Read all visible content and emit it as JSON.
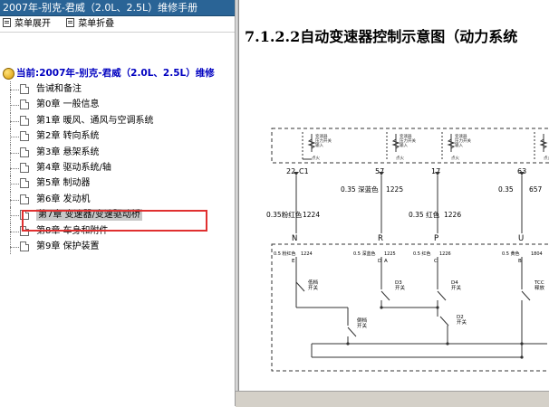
{
  "window": {
    "title": "2007年-别克-君威（2.0L、2.5L）维修手册"
  },
  "toolbar": {
    "expand_label": "菜单展开",
    "collapse_label": "菜单折叠"
  },
  "tree": {
    "root_label": "当前:2007年-别克-君威（2.0L、2.5L）维修",
    "items": [
      {
        "label": "告诫和备注"
      },
      {
        "label": "第0章 一般信息"
      },
      {
        "label": "第1章 暖风、通风与空调系统"
      },
      {
        "label": "第2章 转向系统"
      },
      {
        "label": "第3章 悬架系统"
      },
      {
        "label": "第4章 驱动系统/轴"
      },
      {
        "label": "第5章 制动器"
      },
      {
        "label": "第6章 发动机"
      },
      {
        "label": "第7章 变速器/变速驱动桥"
      },
      {
        "label": "第8章 车身和附件"
      },
      {
        "label": "第9章 保护装置"
      }
    ],
    "selected_index": 8
  },
  "content": {
    "title": "7.1.2.2自动变速器控制示意图（动力系统",
    "diagram": {
      "module_label": "变速器\n压力开关\n输入",
      "ignition_label": "点火",
      "pins_top": [
        "22",
        "C1",
        "57",
        "17",
        "63"
      ],
      "wires": [
        "0.35 深蓝色",
        "1225",
        "0.35 红色",
        "1226",
        "0.35",
        "657",
        "0.35粉红色",
        "1224"
      ],
      "letters": [
        "N",
        "R",
        "P",
        "U"
      ],
      "lower_wires": [
        "0.5 粉红色",
        "1224",
        "0.5 深蓝色",
        "1225",
        "0.5 红色",
        "1226",
        "0.5 黄色",
        "1804"
      ],
      "pins_bottom": [
        "E",
        "D",
        "A",
        "C",
        "B"
      ],
      "switches": [
        "低档\n开关",
        "D3\n开关",
        "D4\n开关",
        "D2\n开关",
        "倒档\n开关",
        "TCC\n释放"
      ]
    }
  }
}
